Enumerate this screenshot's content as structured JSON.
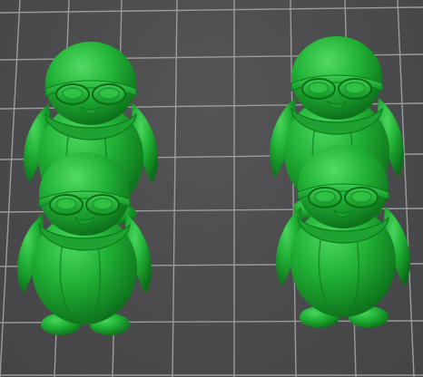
{
  "scene": {
    "bed_color": "#4b4b4d",
    "grid_color": "#a4a4a6",
    "model_color": "#1fae34",
    "model_highlight": "#46d35a",
    "model_shadow": "#0b6a18"
  },
  "models": [
    {
      "name": "penguin-with-goggles-1"
    },
    {
      "name": "penguin-with-goggles-2"
    },
    {
      "name": "penguin-with-goggles-3"
    },
    {
      "name": "penguin-with-goggles-4"
    }
  ]
}
